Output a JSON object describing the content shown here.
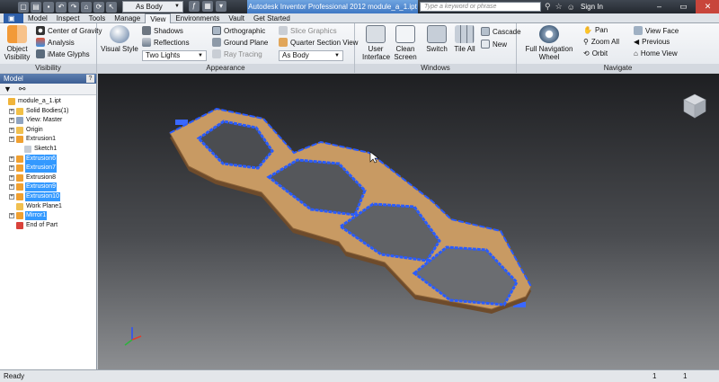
{
  "titlebar": {
    "title": "Autodesk Inventor Professional 2012   module_a_1.ipt",
    "body_select": "As Body",
    "search_placeholder": "Type a keyword or phrase",
    "sign_in": "Sign In"
  },
  "tabs": [
    {
      "label": "Model"
    },
    {
      "label": "Inspect"
    },
    {
      "label": "Tools"
    },
    {
      "label": "Manage"
    },
    {
      "label": "View"
    },
    {
      "label": "Environments"
    },
    {
      "label": "Vault"
    },
    {
      "label": "Get Started"
    }
  ],
  "ribbon": {
    "visibility": {
      "title": "Visibility",
      "object_visibility": "Object Visibility",
      "center_of_gravity": "Center of Gravity",
      "analysis": "Analysis",
      "imate_glyphs": "iMate Glyphs"
    },
    "appearance": {
      "title": "Appearance",
      "visual_style": "Visual Style",
      "shadows": "Shadows",
      "reflections": "Reflections",
      "lights_select": "Two Lights",
      "orthographic": "Orthographic",
      "ground_plane": "Ground Plane",
      "ray_tracing": "Ray Tracing",
      "slice_graphics": "Slice Graphics",
      "quarter_section_view": "Quarter Section View",
      "body_select": "As Body"
    },
    "windows": {
      "title": "Windows",
      "user_interface": "User Interface",
      "clean_screen": "Clean Screen",
      "switch": "Switch",
      "tile_all": "Tile All",
      "cascade": "Cascade",
      "new": "New"
    },
    "navigate": {
      "title": "Navigate",
      "full_navigation_wheel": "Full Navigation Wheel",
      "pan": "Pan",
      "zoom_all": "Zoom All",
      "orbit": "Orbit",
      "view_face": "View Face",
      "previous": "Previous",
      "home_view": "Home View"
    }
  },
  "browser": {
    "title": "Model",
    "items": [
      {
        "label": "module_a_1.ipt",
        "selected": false
      },
      {
        "label": "Solid Bodies(1)",
        "selected": false
      },
      {
        "label": "View: Master",
        "selected": false
      },
      {
        "label": "Origin",
        "selected": false
      },
      {
        "label": "Extrusion1",
        "selected": false
      },
      {
        "label": "Sketch1",
        "selected": false
      },
      {
        "label": "Extrusion6",
        "selected": true
      },
      {
        "label": "Extrusion7",
        "selected": true
      },
      {
        "label": "Extrusion8",
        "selected": false
      },
      {
        "label": "Extrusion9",
        "selected": true
      },
      {
        "label": "Extrusion10",
        "selected": true
      },
      {
        "label": "Work Plane1",
        "selected": false
      },
      {
        "label": "Mirror1",
        "selected": true
      },
      {
        "label": "End of Part",
        "selected": false
      }
    ]
  },
  "statusbar": {
    "status": "Ready",
    "count_a": "1",
    "count_b": "1"
  },
  "colors": {
    "selection": "#3399ff",
    "wood": "#c89a63",
    "highlight_edges": "#2a5cff",
    "file_tab": "#2d5ea8"
  }
}
